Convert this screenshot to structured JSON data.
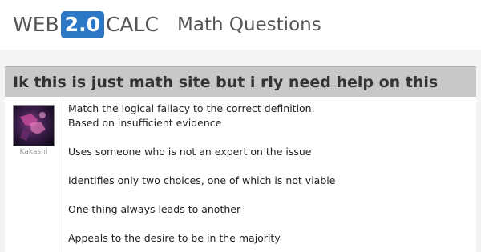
{
  "header": {
    "logo": {
      "prefix": "WEB",
      "version": "2.0",
      "suffix": "CALC"
    },
    "subtitle": "Math Questions"
  },
  "question": {
    "title": "Ik this is just math site but i rly need help on this",
    "author": "Kakashi",
    "lines": [
      "Match the logical fallacy to the correct definition.",
      "Based on insufficient evidence",
      "Uses someone who is not an expert on the issue",
      "Identifies only two choices, one of which is not viable",
      "One thing always leads to another",
      "Appeals to the desire to be in the majority"
    ]
  },
  "colors": {
    "brand_blue": "#2d78c6",
    "title_bar": "#c8c8c8",
    "header_text": "#555555"
  }
}
